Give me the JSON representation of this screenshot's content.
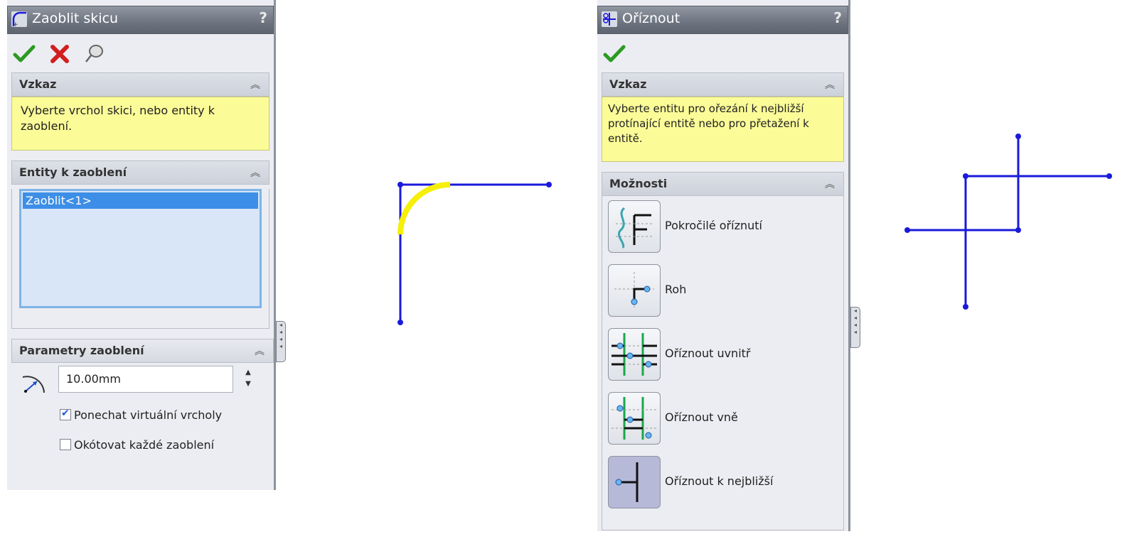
{
  "fillet_panel": {
    "title": "Zaoblit skicu",
    "help": "?",
    "message_header": "Vzkaz",
    "message_text": "Vyberte vrchol skici, nebo entity k zaoblení.",
    "entities_header": "Entity k zaoblení",
    "entities_items": [
      "Zaoblit<1>"
    ],
    "params_header": "Parametry zaoblení",
    "radius_value": "10.00mm",
    "keep_virtual_label": "Ponechat virtuální vrcholy",
    "keep_virtual_checked": true,
    "dimension_each_label": "Okótovat každé zaoblení",
    "dimension_each_checked": false,
    "collapse_glyph": "≈"
  },
  "trim_panel": {
    "title": "Oříznout",
    "help": "?",
    "message_header": "Vzkaz",
    "message_text": "Vyberte entitu pro ořezání k nejbližší protínající entitě nebo pro přetažení k entitě.",
    "options_header": "Možnosti",
    "options": [
      {
        "label": "Pokročilé oříznutí",
        "icon": "power-trim-icon"
      },
      {
        "label": "Roh",
        "icon": "corner-icon"
      },
      {
        "label": "Oříznout uvnitř",
        "icon": "trim-inside-icon"
      },
      {
        "label": "Oříznout vně",
        "icon": "trim-outside-icon"
      },
      {
        "label": "Oříznout k nejbližší",
        "icon": "trim-closest-icon"
      }
    ],
    "active_option": "Oříznout k nejbližší"
  },
  "colors": {
    "sketch_line": "#1a1adb",
    "fillet_highlight": "#f5ef0a",
    "ok_green": "#2c9a22",
    "cancel_red": "#d11f1f"
  }
}
